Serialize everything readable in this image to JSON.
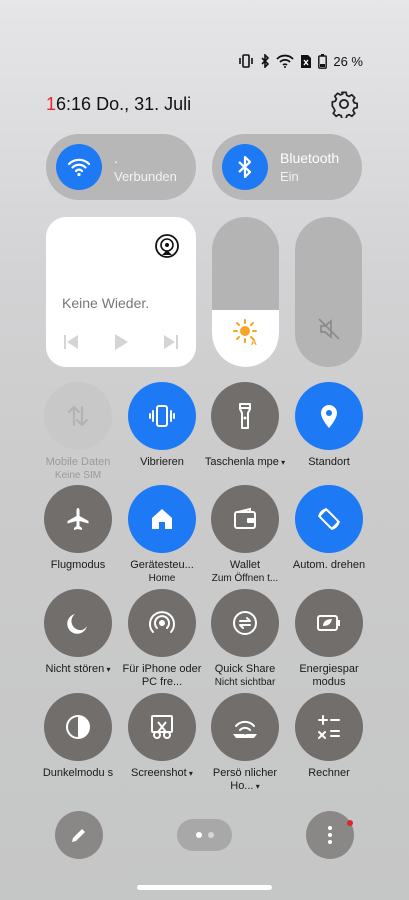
{
  "status_bar": {
    "icons": [
      "vibrate-icon",
      "bluetooth-icon",
      "wifi-icon",
      "sim-off-icon",
      "battery-icon"
    ],
    "battery_text": "26 %"
  },
  "header": {
    "time_first_digit": "1",
    "time_rest": "6:16",
    "date": "Do., 31. Juli",
    "settings_icon": "gear-icon"
  },
  "wifi_pill": {
    "title": ".",
    "subtitle": "Verbunden",
    "icon": "wifi-icon",
    "color": "#1e7af4"
  },
  "bluetooth_pill": {
    "title": "Bluetooth",
    "subtitle": "Ein",
    "icon": "bluetooth-icon",
    "color": "#1e7af4"
  },
  "media": {
    "title": "Keine Wieder.",
    "icons": [
      "cast-icon",
      "previous-icon",
      "play-icon",
      "next-icon"
    ]
  },
  "brightness": {
    "level": 0.38,
    "icon": "sun-auto-icon",
    "icon_color": "#f5a623"
  },
  "volume": {
    "level": 0.0,
    "icon": "mute-icon"
  },
  "tiles": [
    {
      "label": "Mobile Daten",
      "sub": "Keine SIM",
      "icon": "mobile-data-icon",
      "state": "disabled",
      "caret": false
    },
    {
      "label": "Vibrieren",
      "sub": "",
      "icon": "vibrate-icon",
      "state": "on",
      "caret": false
    },
    {
      "label": "Taschenla mpe",
      "sub": "",
      "icon": "flashlight-icon",
      "state": "off",
      "caret": true
    },
    {
      "label": "Standort",
      "sub": "",
      "icon": "location-icon",
      "state": "on",
      "caret": false
    },
    {
      "label": "Flugmodus",
      "sub": "",
      "icon": "airplane-icon",
      "state": "off",
      "caret": false
    },
    {
      "label": "Gerätesteu...",
      "sub": "Home",
      "icon": "home-icon",
      "state": "on",
      "caret": false
    },
    {
      "label": "Wallet",
      "sub": "Zum Öffnen t...",
      "icon": "wallet-icon",
      "state": "off",
      "caret": false
    },
    {
      "label": "Autom. drehen",
      "sub": "",
      "icon": "auto-rotate-icon",
      "state": "on",
      "caret": false
    },
    {
      "label": "Nicht stören",
      "sub": "",
      "icon": "moon-icon",
      "state": "off",
      "caret": true
    },
    {
      "label": "Für iPhone oder PC fre...",
      "sub": "",
      "icon": "hotspot-icon",
      "state": "off",
      "caret": false
    },
    {
      "label": "Quick Share",
      "sub": "Nicht sichtbar",
      "icon": "quick-share-icon",
      "state": "off",
      "caret": false
    },
    {
      "label": "Energiespar modus",
      "sub": "",
      "icon": "battery-saver-icon",
      "state": "off",
      "caret": false
    },
    {
      "label": "Dunkelmodu s",
      "sub": "",
      "icon": "dark-mode-icon",
      "state": "off",
      "caret": false
    },
    {
      "label": "Screenshot",
      "sub": "",
      "icon": "screenshot-icon",
      "state": "off",
      "caret": true
    },
    {
      "label": "Persö nlicher Ho...",
      "sub": "",
      "icon": "personal-hotspot-icon",
      "state": "off",
      "caret": true
    },
    {
      "label": "Rechner",
      "sub": "",
      "icon": "calculator-icon",
      "state": "off",
      "caret": false
    }
  ],
  "bottom": {
    "edit_icon": "pencil-icon",
    "more_icon": "more-vertical-icon",
    "page_count": 2,
    "current_page": 1,
    "notification_dot_color": "#e0262c"
  }
}
